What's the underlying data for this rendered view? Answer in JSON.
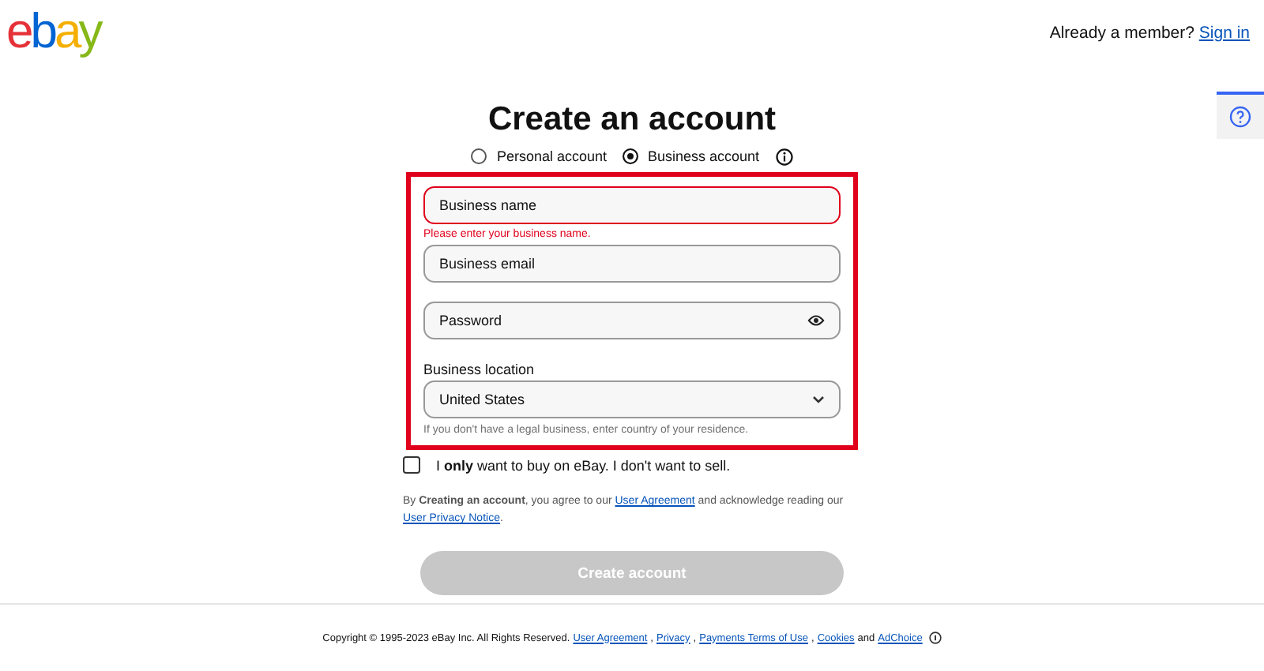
{
  "logo": [
    {
      "text": "e",
      "color": "#e53238"
    },
    {
      "text": "b",
      "color": "#0064d2"
    },
    {
      "text": "a",
      "color": "#f5af02"
    },
    {
      "text": "y",
      "color": "#86b817"
    }
  ],
  "header": {
    "prompt": "Already a member?",
    "link": "Sign in"
  },
  "title": "Create an account",
  "account_types": [
    {
      "label": "Personal account",
      "selected": false
    },
    {
      "label": "Business account",
      "selected": true
    }
  ],
  "form": {
    "highlighted": true,
    "fields": [
      {
        "kind": "text",
        "placeholder": "Business name",
        "error": "Please enter your business name.",
        "invalid": true
      },
      {
        "kind": "text",
        "placeholder": "Business email",
        "invalid": false
      },
      {
        "kind": "password",
        "placeholder": "Password",
        "invalid": false
      },
      {
        "kind": "select",
        "label": "Business location",
        "value": "United States",
        "hint": "If you don't have a legal business, enter country of your residence.",
        "invalid": false
      }
    ]
  },
  "buy_only": {
    "text": "I **only** want to buy on eBay. I don't want to sell.",
    "checked": false
  },
  "terms": {
    "before": "By **Creating an account**, you agree to our",
    "link1": "User Agreement",
    "middle": "and acknowledge reading our",
    "link2": "User Privacy Notice",
    "after": "."
  },
  "submit": {
    "label": "Create account",
    "disabled": true
  },
  "footer": {
    "copyright": "Copyright © 1995-2023 eBay Inc. All Rights Reserved.",
    "links": [
      {
        "text": "User Agreement",
        "sep": ","
      },
      {
        "text": "Privacy",
        "sep": ","
      },
      {
        "text": "Payments Terms of Use",
        "sep": ","
      },
      {
        "text": "Cookies"
      }
    ],
    "and": "and",
    "adchoice": "AdChoice"
  }
}
